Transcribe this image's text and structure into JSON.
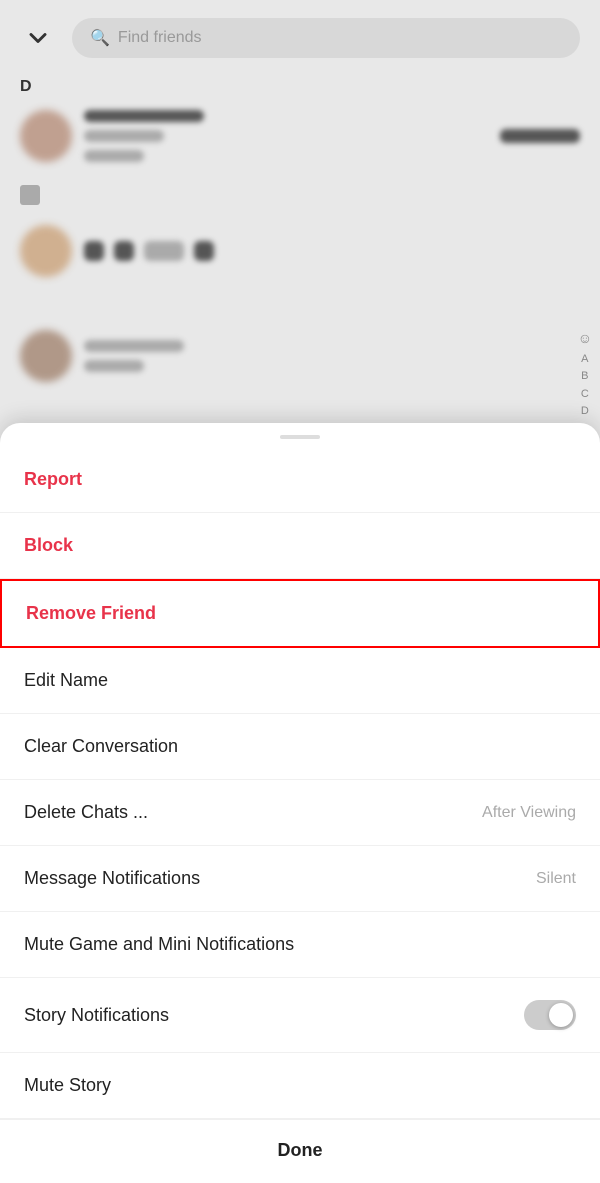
{
  "topBar": {
    "chevron": "chevron-down",
    "search": {
      "placeholder": "Find friends"
    }
  },
  "sectionLabel": "D",
  "indexLetters": [
    "A",
    "B",
    "C",
    "D"
  ],
  "bottomSheet": {
    "menuItems": [
      {
        "id": "report",
        "label": "Report",
        "value": "",
        "style": "red",
        "type": "action",
        "highlighted": false
      },
      {
        "id": "block",
        "label": "Block",
        "value": "",
        "style": "red",
        "type": "action",
        "highlighted": false
      },
      {
        "id": "remove-friend",
        "label": "Remove Friend",
        "value": "",
        "style": "red",
        "type": "action",
        "highlighted": true
      },
      {
        "id": "edit-name",
        "label": "Edit Name",
        "value": "",
        "style": "normal",
        "type": "action",
        "highlighted": false
      },
      {
        "id": "clear-conversation",
        "label": "Clear Conversation",
        "value": "",
        "style": "normal",
        "type": "action",
        "highlighted": false
      },
      {
        "id": "delete-chats",
        "label": "Delete Chats ...",
        "value": "After Viewing",
        "style": "normal",
        "type": "value",
        "highlighted": false
      },
      {
        "id": "message-notifications",
        "label": "Message Notifications",
        "value": "Silent",
        "style": "normal",
        "type": "value",
        "highlighted": false
      },
      {
        "id": "mute-game-notifications",
        "label": "Mute Game and Mini Notifications",
        "value": "",
        "style": "normal",
        "type": "action",
        "highlighted": false
      },
      {
        "id": "story-notifications",
        "label": "Story Notifications",
        "value": "",
        "style": "normal",
        "type": "toggle",
        "toggleOn": false,
        "highlighted": false
      },
      {
        "id": "mute-story",
        "label": "Mute Story",
        "value": "",
        "style": "normal",
        "type": "action",
        "highlighted": false
      }
    ],
    "doneLabel": "Done"
  }
}
